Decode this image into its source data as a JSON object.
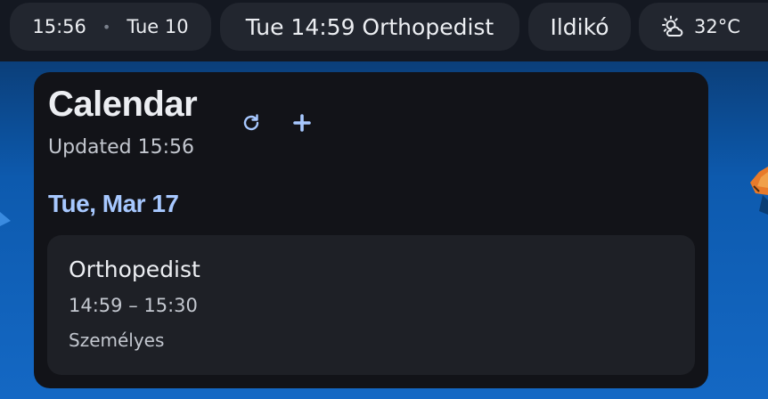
{
  "topbar": {
    "clock": {
      "time": "15:56",
      "separator": "•",
      "date": "Tue 10"
    },
    "next_event": "Tue 14:59 Orthopedist",
    "user": "Ildikó",
    "weather": {
      "temperature": "32°C",
      "icon": "partly-sunny-icon"
    }
  },
  "calendar": {
    "title": "Calendar",
    "updated": "Updated 15:56",
    "refresh_icon": "refresh-icon",
    "add_icon": "plus-icon",
    "accent_color": "#a7c8ff",
    "days": [
      {
        "heading": "Tue, Mar 17",
        "events": [
          {
            "title": "Orthopedist",
            "time": "14:59 – 15:30",
            "calendar": "Személyes"
          }
        ]
      }
    ]
  }
}
